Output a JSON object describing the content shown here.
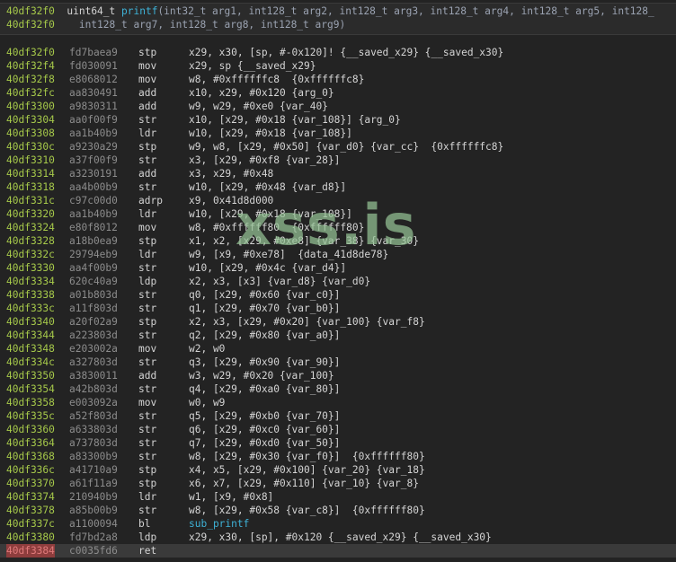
{
  "header": {
    "address": "40df32f0",
    "return_type": "uint64_t",
    "function_name": "printf",
    "params_line1": "(int32_t arg1, int128_t arg2, int128_t arg3, int128_t arg4, int128_t arg5, int128_",
    "address2": "40df32f0",
    "params_line2": "    int128_t arg7, int128_t arg8, int128_t arg9)"
  },
  "rows": [
    {
      "addr": "40df32f0",
      "bytes": "fd7baea9",
      "mnem": "stp",
      "ops": "x29, x30, [sp, #-0x120]! {__saved_x29} {__saved_x30}"
    },
    {
      "addr": "40df32f4",
      "bytes": "fd030091",
      "mnem": "mov",
      "ops": "x29, sp {__saved_x29}"
    },
    {
      "addr": "40df32f8",
      "bytes": "e8068012",
      "mnem": "mov",
      "ops": "w8, #0xffffffc8  {0xffffffc8}"
    },
    {
      "addr": "40df32fc",
      "bytes": "aa830491",
      "mnem": "add",
      "ops": "x10, x29, #0x120 {arg_0}"
    },
    {
      "addr": "40df3300",
      "bytes": "a9830311",
      "mnem": "add",
      "ops": "w9, w29, #0xe0 {var_40}"
    },
    {
      "addr": "40df3304",
      "bytes": "aa0f00f9",
      "mnem": "str",
      "ops": "x10, [x29, #0x18 {var_108}] {arg_0}"
    },
    {
      "addr": "40df3308",
      "bytes": "aa1b40b9",
      "mnem": "ldr",
      "ops": "w10, [x29, #0x18 {var_108}]"
    },
    {
      "addr": "40df330c",
      "bytes": "a9230a29",
      "mnem": "stp",
      "ops": "w9, w8, [x29, #0x50] {var_d0} {var_cc}  {0xffffffc8}"
    },
    {
      "addr": "40df3310",
      "bytes": "a37f00f9",
      "mnem": "str",
      "ops": "x3, [x29, #0xf8 {var_28}]"
    },
    {
      "addr": "40df3314",
      "bytes": "a3230191",
      "mnem": "add",
      "ops": "x3, x29, #0x48"
    },
    {
      "addr": "40df3318",
      "bytes": "aa4b00b9",
      "mnem": "str",
      "ops": "w10, [x29, #0x48 {var_d8}]"
    },
    {
      "addr": "40df331c",
      "bytes": "c97c00d0",
      "mnem": "adrp",
      "ops": "x9, 0x41d8d000"
    },
    {
      "addr": "40df3320",
      "bytes": "aa1b40b9",
      "mnem": "ldr",
      "ops": "w10, [x29, #0x18 {var_108}]"
    },
    {
      "addr": "40df3324",
      "bytes": "e80f8012",
      "mnem": "mov",
      "ops": "w8, #0xffffff80  {0xffffff80}"
    },
    {
      "addr": "40df3328",
      "bytes": "a18b0ea9",
      "mnem": "stp",
      "ops": "x1, x2, [x29, #0xe8] {var_38} {var_30}"
    },
    {
      "addr": "40df332c",
      "bytes": "29794eb9",
      "mnem": "ldr",
      "ops": "w9, [x9, #0xe78]  {data_41d8de78}"
    },
    {
      "addr": "40df3330",
      "bytes": "aa4f00b9",
      "mnem": "str",
      "ops": "w10, [x29, #0x4c {var_d4}]"
    },
    {
      "addr": "40df3334",
      "bytes": "620c40a9",
      "mnem": "ldp",
      "ops": "x2, x3, [x3] {var_d8} {var_d0}"
    },
    {
      "addr": "40df3338",
      "bytes": "a01b803d",
      "mnem": "str",
      "ops": "q0, [x29, #0x60 {var_c0}]"
    },
    {
      "addr": "40df333c",
      "bytes": "a11f803d",
      "mnem": "str",
      "ops": "q1, [x29, #0x70 {var_b0}]"
    },
    {
      "addr": "40df3340",
      "bytes": "a20f02a9",
      "mnem": "stp",
      "ops": "x2, x3, [x29, #0x20] {var_100} {var_f8}"
    },
    {
      "addr": "40df3344",
      "bytes": "a223803d",
      "mnem": "str",
      "ops": "q2, [x29, #0x80 {var_a0}]"
    },
    {
      "addr": "40df3348",
      "bytes": "e203002a",
      "mnem": "mov",
      "ops": "w2, w0"
    },
    {
      "addr": "40df334c",
      "bytes": "a327803d",
      "mnem": "str",
      "ops": "q3, [x29, #0x90 {var_90}]"
    },
    {
      "addr": "40df3350",
      "bytes": "a3830011",
      "mnem": "add",
      "ops": "w3, w29, #0x20 {var_100}"
    },
    {
      "addr": "40df3354",
      "bytes": "a42b803d",
      "mnem": "str",
      "ops": "q4, [x29, #0xa0 {var_80}]"
    },
    {
      "addr": "40df3358",
      "bytes": "e003092a",
      "mnem": "mov",
      "ops": "w0, w9"
    },
    {
      "addr": "40df335c",
      "bytes": "a52f803d",
      "mnem": "str",
      "ops": "q5, [x29, #0xb0 {var_70}]"
    },
    {
      "addr": "40df3360",
      "bytes": "a633803d",
      "mnem": "str",
      "ops": "q6, [x29, #0xc0 {var_60}]"
    },
    {
      "addr": "40df3364",
      "bytes": "a737803d",
      "mnem": "str",
      "ops": "q7, [x29, #0xd0 {var_50}]"
    },
    {
      "addr": "40df3368",
      "bytes": "a83300b9",
      "mnem": "str",
      "ops": "w8, [x29, #0x30 {var_f0}]  {0xffffff80}"
    },
    {
      "addr": "40df336c",
      "bytes": "a41710a9",
      "mnem": "stp",
      "ops": "x4, x5, [x29, #0x100] {var_20} {var_18}"
    },
    {
      "addr": "40df3370",
      "bytes": "a61f11a9",
      "mnem": "stp",
      "ops": "x6, x7, [x29, #0x110] {var_10} {var_8}"
    },
    {
      "addr": "40df3374",
      "bytes": "210940b9",
      "mnem": "ldr",
      "ops": "w1, [x9, #0x8]"
    },
    {
      "addr": "40df3378",
      "bytes": "a85b00b9",
      "mnem": "str",
      "ops": "w8, [x29, #0x58 {var_c8}]  {0xffffff80}"
    },
    {
      "addr": "40df337c",
      "bytes": "a1100094",
      "mnem": "bl",
      "ops": "sub_printf"
    },
    {
      "addr": "40df3380",
      "bytes": "fd7bd2a8",
      "mnem": "ldp",
      "ops": "x29, x30, [sp], #0x120 {__saved_x29} {__saved_x30}"
    },
    {
      "addr": "40df3384",
      "bytes": "c0035fd6",
      "mnem": "ret",
      "ops": ""
    }
  ],
  "watermark": "xss.is",
  "colors": {
    "address": "#a6c94a",
    "symbol": "#3eb2d7",
    "selected_address_bg": "#8e3d3d"
  }
}
